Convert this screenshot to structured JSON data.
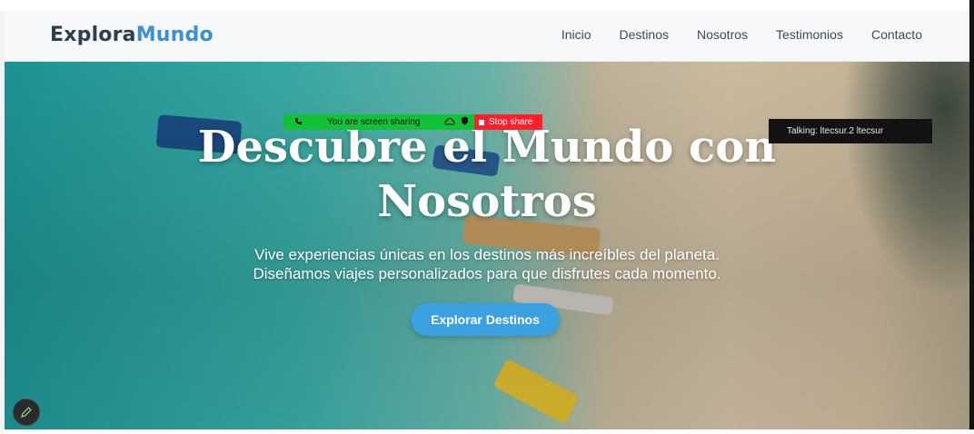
{
  "brand": {
    "part1": "Explora",
    "part2": "Mundo"
  },
  "nav": {
    "items": [
      "Inicio",
      "Destinos",
      "Nosotros",
      "Testimonios",
      "Contacto"
    ]
  },
  "hero": {
    "title_line1": "Descubre el Mundo con",
    "title_line2": "Nosotros",
    "subtitle_line1": "Vive experiencias únicas en los destinos más increíbles del planeta.",
    "subtitle_line2": "Diseñamos viajes personalizados para que disfrutes cada momento.",
    "cta_label": "Explorar Destinos"
  },
  "screen_share": {
    "status": "You are screen sharing",
    "stop_label": "Stop share"
  },
  "talking": {
    "label": "Talking: ltecsur.2 ltecsur"
  },
  "colors": {
    "brand_dark": "#2c3e50",
    "brand_accent": "#3b8fd6",
    "cta": "#3aa0e0",
    "share_green": "#12c236",
    "share_red": "#ff1f2a"
  },
  "icons": [
    "phone-icon",
    "cloud-icon",
    "shield-icon",
    "stop-square-icon",
    "pencil-icon"
  ]
}
